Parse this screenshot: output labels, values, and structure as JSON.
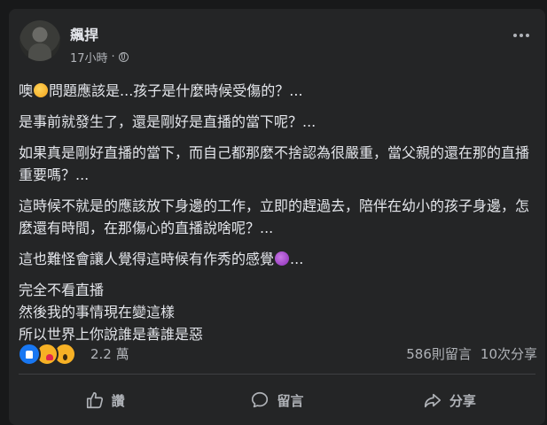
{
  "post": {
    "author": "飆捍",
    "time": "17小時",
    "separator": "·",
    "paragraphs": [
      {
        "text_before": "噢",
        "emoji": "thinking-face",
        "text_after": "問題應該是...孩子是什麼時候受傷的？..."
      },
      {
        "text": "是事前就發生了，還是剛好是直播的當下呢？..."
      },
      {
        "text": "如果真是剛好直播的當下，而自己都那麼不捨認為很嚴重，當父親的還在那的直播重要嗎？..."
      },
      {
        "text": "這時候不就是的應該放下身邊的工作，立即的趕過去，陪伴在幼小的孩子身邊，怎麼還有時間，在那傷心的直播說啥呢？..."
      },
      {
        "text_before": "這也難怪會讓人覺得這時候有作秀的感覺",
        "emoji": "tired-face",
        "text_after": "..."
      },
      {
        "lines": [
          "完全不看直播",
          "然後我的事情現在變這樣",
          "所以世界上你說誰是善誰是惡"
        ]
      }
    ]
  },
  "stats": {
    "reaction_icons": [
      "like-icon",
      "care-icon",
      "wow-icon"
    ],
    "reaction_count": "2.2 萬",
    "comments": "586則留言",
    "shares": "10次分享"
  },
  "actions": {
    "like": "讚",
    "comment": "留言",
    "share": "分享"
  },
  "colors": {
    "background": "#18191a",
    "card": "#242526",
    "text": "#e4e6eb",
    "secondary": "#b0b3b8",
    "like_blue": "#1877f2"
  }
}
